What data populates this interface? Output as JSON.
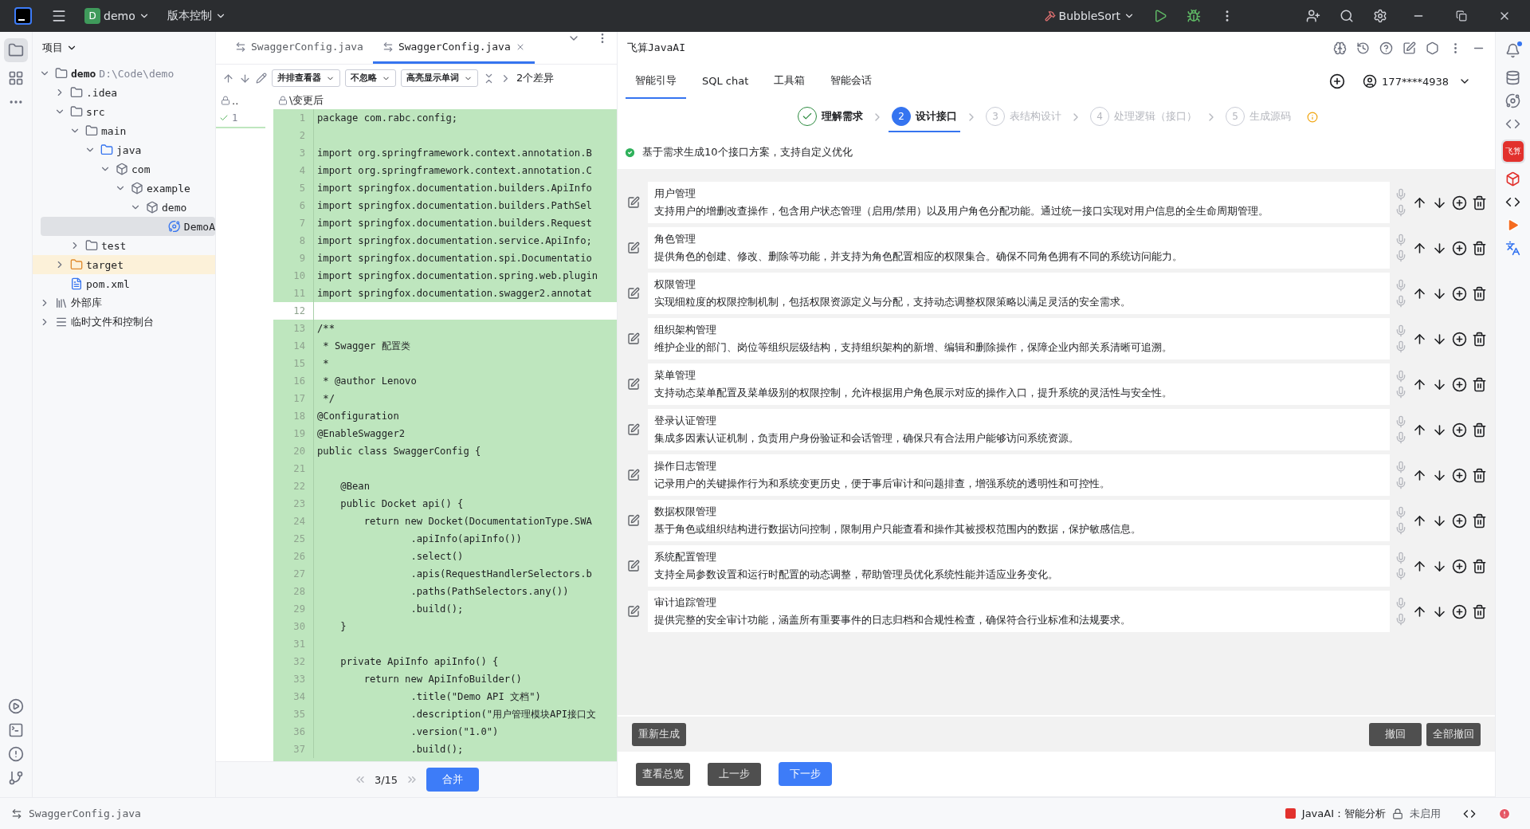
{
  "top_bar": {
    "project_badge": "D",
    "project": "demo",
    "vcs": "版本控制",
    "run_config": "BubbleSort"
  },
  "project_panel": {
    "title": "项目",
    "tree": [
      {
        "label": "demo",
        "path": "D:\\Code\\demo",
        "kind": "module",
        "expanded": true,
        "selected": false,
        "children": [
          {
            "label": ".idea",
            "kind": "folder",
            "expanded": false,
            "selected": false
          },
          {
            "label": "src",
            "kind": "folder",
            "expanded": true,
            "selected": false,
            "children": [
              {
                "label": "main",
                "kind": "folder",
                "expanded": true,
                "selected": false,
                "children": [
                  {
                    "label": "java",
                    "kind": "source",
                    "expanded": true,
                    "selected": false,
                    "children": [
                      {
                        "label": "com",
                        "kind": "package",
                        "expanded": true,
                        "selected": false,
                        "children": [
                          {
                            "label": "example",
                            "kind": "package",
                            "expanded": true,
                            "selected": false,
                            "children": [
                              {
                                "label": "demo",
                                "kind": "package",
                                "expanded": true,
                                "selected": false,
                                "children": [
                                  {
                                    "label": "DemoA",
                                    "kind": "class",
                                    "selected": true
                                  }
                                ]
                              }
                            ]
                          }
                        ]
                      }
                    ]
                  }
                ]
              },
              {
                "label": "test",
                "kind": "folder",
                "expanded": false,
                "selected": false
              }
            ]
          },
          {
            "label": "target",
            "kind": "excluded",
            "expanded": false,
            "selected": false
          },
          {
            "label": "pom.xml",
            "kind": "maven",
            "selected": false
          }
        ]
      },
      {
        "label": "外部库",
        "kind": "library",
        "expanded": false,
        "selected": false
      },
      {
        "label": "临时文件和控制台",
        "kind": "scratch",
        "expanded": false,
        "selected": false
      }
    ]
  },
  "editor": {
    "tabs": [
      {
        "label": "SwaggerConfig.java",
        "selected": false
      },
      {
        "label": "SwaggerConfig.java",
        "selected": true
      }
    ],
    "toolbar": {
      "viewer": "并排查看器",
      "ignore": "不忽略",
      "highlight": "高亮显示单词",
      "diff_count": "2个差异"
    },
    "left_path": "..",
    "right_path": "\\变更后",
    "left_line": "1",
    "lines": [
      {
        "number": "1",
        "text": "package com.rabc.config;",
        "changed": true
      },
      {
        "number": "2",
        "changed": true
      },
      {
        "number": "3",
        "text": "import org.springframework.context.annotation.B",
        "changed": true
      },
      {
        "number": "4",
        "text": "import org.springframework.context.annotation.C",
        "changed": true
      },
      {
        "number": "5",
        "text": "import springfox.documentation.builders.ApiInfo",
        "changed": true
      },
      {
        "number": "6",
        "text": "import springfox.documentation.builders.PathSel",
        "changed": true
      },
      {
        "number": "7",
        "text": "import springfox.documentation.builders.Request",
        "changed": true
      },
      {
        "number": "8",
        "text": "import springfox.documentation.service.ApiInfo;",
        "changed": true
      },
      {
        "number": "9",
        "text": "import springfox.documentation.spi.Documentatio",
        "changed": true
      },
      {
        "number": "10",
        "text": "import springfox.documentation.spring.web.plugin",
        "changed": true
      },
      {
        "number": "11",
        "text": "import springfox.documentation.swagger2.annotat",
        "changed": true
      },
      {
        "number": "12",
        "changed": false
      },
      {
        "number": "13",
        "text": "/**",
        "changed": true
      },
      {
        "number": "14",
        "text": " * Swagger 配置类",
        "changed": true
      },
      {
        "number": "15",
        "text": " *",
        "changed": true
      },
      {
        "number": "16",
        "text": " * @author Lenovo",
        "changed": true
      },
      {
        "number": "17",
        "text": " */",
        "changed": true
      },
      {
        "number": "18",
        "text": "@Configuration",
        "changed": true
      },
      {
        "number": "19",
        "text": "@EnableSwagger2",
        "changed": true
      },
      {
        "number": "20",
        "text": "public class SwaggerConfig {",
        "changed": true
      },
      {
        "number": "21",
        "changed": true
      },
      {
        "number": "22",
        "text": "    @Bean",
        "changed": true
      },
      {
        "number": "23",
        "text": "    public Docket api() {",
        "changed": true
      },
      {
        "number": "24",
        "text": "        return new Docket(DocumentationType.SWA",
        "changed": true
      },
      {
        "number": "25",
        "text": "                .apiInfo(apiInfo())",
        "changed": true
      },
      {
        "number": "26",
        "text": "                .select()",
        "changed": true
      },
      {
        "number": "27",
        "text": "                .apis(RequestHandlerSelectors.b",
        "changed": true
      },
      {
        "number": "28",
        "text": "                .paths(PathSelectors.any())",
        "changed": true
      },
      {
        "number": "29",
        "text": "                .build();",
        "changed": true
      },
      {
        "number": "30",
        "text": "    }",
        "changed": true
      },
      {
        "number": "31",
        "changed": true
      },
      {
        "number": "32",
        "text": "    private ApiInfo apiInfo() {",
        "changed": true
      },
      {
        "number": "33",
        "text": "        return new ApiInfoBuilder()",
        "changed": true
      },
      {
        "number": "34",
        "text": "                .title(\"Demo API 文档\")",
        "changed": true
      },
      {
        "number": "35",
        "text": "                .description(\"用户管理模块API接口文",
        "changed": true
      },
      {
        "number": "36",
        "text": "                .version(\"1.0\")",
        "changed": true
      },
      {
        "number": "37",
        "text": "                .build();",
        "changed": true
      }
    ],
    "nav": {
      "position": "3/15",
      "merge": "合并"
    }
  },
  "ai_panel": {
    "title": "飞算JavaAI",
    "account": "177****4938",
    "tabs": [
      {
        "label": "智能引导",
        "selected": true
      },
      {
        "label": "SQL chat",
        "selected": false
      },
      {
        "label": "工具箱",
        "selected": false
      },
      {
        "label": "智能会话",
        "selected": false
      }
    ],
    "steps": [
      {
        "label": "理解需求",
        "done": true,
        "selected": false
      },
      {
        "number": "2",
        "label": "设计接口",
        "done": false,
        "selected": true
      },
      {
        "number": "3",
        "label": "表结构设计",
        "done": false,
        "selected": false
      },
      {
        "number": "4",
        "label": "处理逻辑（接口）",
        "done": false,
        "selected": false
      },
      {
        "number": "5",
        "label": "生成源码",
        "done": false,
        "selected": false
      }
    ],
    "info": "基于需求生成10个接口方案，支持自定义优化",
    "items": [
      {
        "title": "用户管理",
        "description": "支持用户的增删改查操作，包含用户状态管理（启用/禁用）以及用户角色分配功能。通过统一接口实现对用户信息的全生命周期管理。"
      },
      {
        "title": "角色管理",
        "description": "提供角色的创建、修改、删除等功能，并支持为角色配置相应的权限集合。确保不同角色拥有不同的系统访问能力。"
      },
      {
        "title": "权限管理",
        "description": "实现细粒度的权限控制机制，包括权限资源定义与分配，支持动态调整权限策略以满足灵活的安全需求。"
      },
      {
        "title": "组织架构管理",
        "description": "维护企业的部门、岗位等组织层级结构，支持组织架构的新增、编辑和删除操作，保障企业内部关系清晰可追溯。"
      },
      {
        "title": "菜单管理",
        "description": "支持动态菜单配置及菜单级别的权限控制，允许根据用户角色展示对应的操作入口，提升系统的灵活性与安全性。"
      },
      {
        "title": "登录认证管理",
        "description": "集成多因素认证机制，负责用户身份验证和会话管理，确保只有合法用户能够访问系统资源。"
      },
      {
        "title": "操作日志管理",
        "description": "记录用户的关键操作行为和系统变更历史，便于事后审计和问题排查，增强系统的透明性和可控性。"
      },
      {
        "title": "数据权限管理",
        "description": "基于角色或组织结构进行数据访问控制，限制用户只能查看和操作其被授权范围内的数据，保护敏感信息。"
      },
      {
        "title": "系统配置管理",
        "description": "支持全局参数设置和运行时配置的动态调整，帮助管理员优化系统性能并适应业务变化。"
      },
      {
        "title": "审计追踪管理",
        "description": "提供完整的安全审计功能，涵盖所有重要事件的日志归档和合规性检查，确保符合行业标准和法规要求。"
      }
    ],
    "regenerate": "重新生成",
    "undo": "撤回",
    "undo_all": "全部撤回",
    "overview": "查看总览",
    "prev": "上一步",
    "next": "下一步"
  },
  "right_strip": {
    "logo": "飞算"
  },
  "status_bar": {
    "file": "SwaggerConfig.java",
    "plugin": "JavaAI：智能分析",
    "state": "未启用"
  }
}
